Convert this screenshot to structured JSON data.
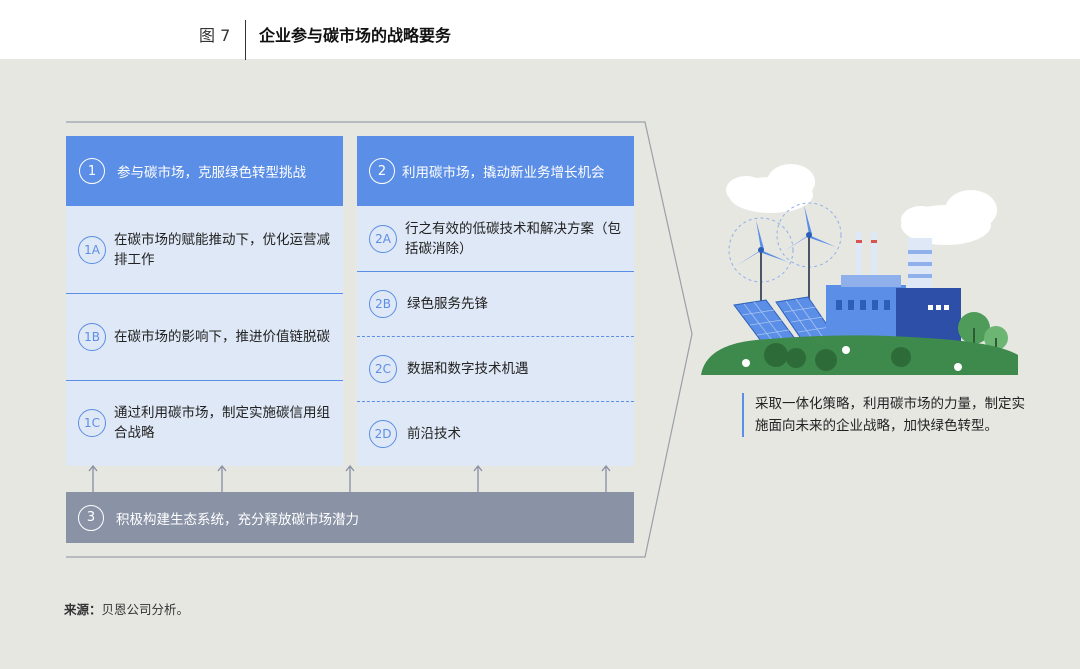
{
  "figure": {
    "label": "图 7",
    "title": "企业参与碳市场的战略要务"
  },
  "column1": {
    "num": "1",
    "title": "参与碳市场，克服绿色转型挑战",
    "items": [
      {
        "badge": "1A",
        "text": "在碳市场的赋能推动下，优化运营减排工作"
      },
      {
        "badge": "1B",
        "text": "在碳市场的影响下，推进价值链脱碳"
      },
      {
        "badge": "1C",
        "text": "通过利用碳市场，制定实施碳信用组合战略"
      }
    ]
  },
  "column2": {
    "num": "2",
    "title": "利用碳市场，撬动新业务增长机会",
    "items": [
      {
        "badge": "2A",
        "text": "行之有效的低碳技术和解决方案（包括碳消除）"
      },
      {
        "badge": "2B",
        "text": "绿色服务先锋"
      },
      {
        "badge": "2C",
        "text": "数据和数字技术机遇"
      },
      {
        "badge": "2D",
        "text": "前沿技术"
      }
    ]
  },
  "foundation": {
    "num": "3",
    "text": "积极构建生态系统，充分释放碳市场潜力"
  },
  "summary": "采取一体化策略，利用碳市场的力量，制定实施面向未来的企业战略，加快绿色转型。",
  "source": {
    "label": "来源：",
    "text": "贝恩公司分析。"
  },
  "colors": {
    "background": "#e7e7e2",
    "accent_blue": "#5b8ee6",
    "light_blue": "#dfe8f6",
    "foundation_gray": "#8a93a6",
    "grass_green": "#3e8a4c"
  },
  "icons": [
    "wind-turbine-icon",
    "solar-panel-icon",
    "factory-icon",
    "tree-icon",
    "cloud-icon"
  ]
}
